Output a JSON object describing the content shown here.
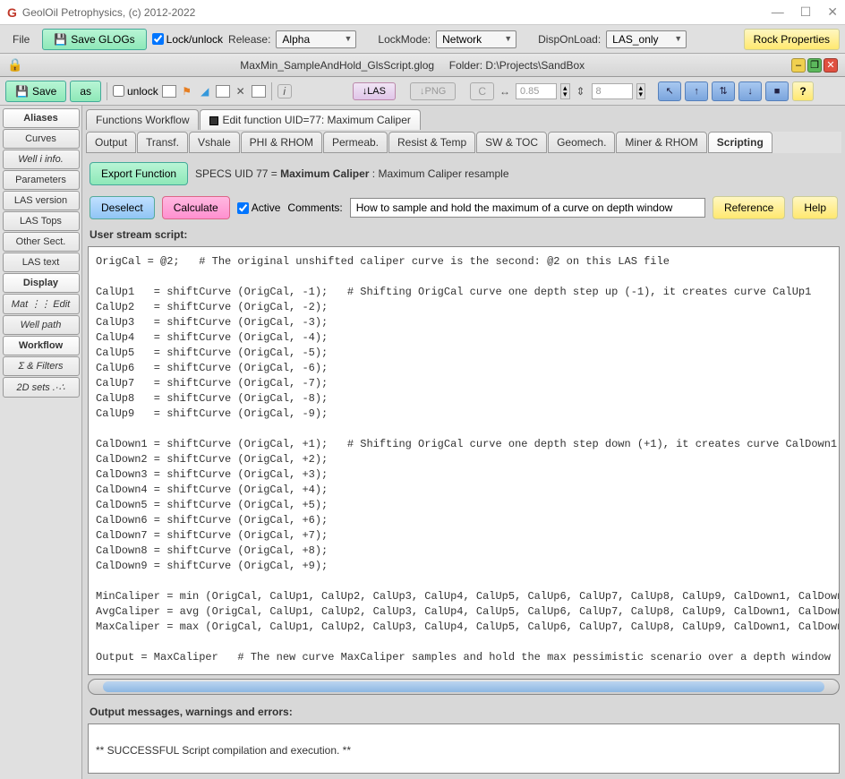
{
  "title": "GeolOil Petrophysics, (c) 2012-2022",
  "menubar": {
    "file": "File",
    "save_glogs": "Save GLOGs",
    "lock_unlock": "Lock/unlock",
    "release_lbl": "Release:",
    "release_val": "Alpha",
    "lockmode_lbl": "LockMode:",
    "lockmode_val": "Network",
    "disp_lbl": "DispOnLoad:",
    "disp_val": "LAS_only",
    "rock": "Rock Properties"
  },
  "filebar": {
    "filename": "MaxMin_SampleAndHold_GlsScript.glog",
    "folder": "Folder: D:\\Projects\\SandBox"
  },
  "toolbar": {
    "save": "Save",
    "as": "as",
    "unlock": "unlock",
    "las": "↓LAS",
    "png": "↓PNG",
    "c": "C",
    "zoom": "0.85",
    "val": "8",
    "help": "?"
  },
  "sidebar": [
    {
      "label": "Aliases",
      "bold": true
    },
    {
      "label": "Curves"
    },
    {
      "label": "Well i info.",
      "italic": true
    },
    {
      "label": "Parameters"
    },
    {
      "label": "LAS version"
    },
    {
      "label": "LAS Tops"
    },
    {
      "label": "Other Sect."
    },
    {
      "label": "LAS text"
    },
    {
      "label": "Display",
      "bold": true
    },
    {
      "label": "Mat ⋮⋮ Edit",
      "italic": true
    },
    {
      "label": "Well path",
      "italic": true
    },
    {
      "label": "Workflow",
      "bold": true
    },
    {
      "label": "Σ & Filters",
      "italic": true
    },
    {
      "label": "2D sets .·∴",
      "italic": true
    }
  ],
  "tabs": {
    "functions": "Functions Workflow",
    "edit": "Edit function UID=77: Maximum Caliper"
  },
  "subtabs": [
    "Output",
    "Transf.",
    "Vshale",
    "PHI & RHOM",
    "Permeab.",
    "Resist & Temp",
    "SW & TOC",
    "Geomech.",
    "Miner & RHOM",
    "Scripting"
  ],
  "actions": {
    "export": "Export Function",
    "specs_prefix": "SPECS UID 77 = ",
    "specs_name": "Maximum Caliper",
    "specs_desc": " : Maximum Caliper resample",
    "deselect": "Deselect",
    "calculate": "Calculate",
    "active": "Active",
    "comments_lbl": "Comments:",
    "comments_val": "How to sample and hold the maximum of a curve on depth window",
    "reference": "Reference",
    "help": "Help"
  },
  "labels": {
    "user_stream": "User stream script:",
    "output_msgs": "Output messages, warnings and errors:"
  },
  "script": "OrigCal = @2;   # The original unshifted caliper curve is the second: @2 on this LAS file\n\nCalUp1   = shiftCurve (OrigCal, -1);   # Shifting OrigCal curve one depth step up (-1), it creates curve CalUp1\nCalUp2   = shiftCurve (OrigCal, -2);\nCalUp3   = shiftCurve (OrigCal, -3);\nCalUp4   = shiftCurve (OrigCal, -4);\nCalUp5   = shiftCurve (OrigCal, -5);\nCalUp6   = shiftCurve (OrigCal, -6);\nCalUp7   = shiftCurve (OrigCal, -7);\nCalUp8   = shiftCurve (OrigCal, -8);\nCalUp9   = shiftCurve (OrigCal, -9);\n\nCalDown1 = shiftCurve (OrigCal, +1);   # Shifting OrigCal curve one depth step down (+1), it creates curve CalDown1\nCalDown2 = shiftCurve (OrigCal, +2);\nCalDown3 = shiftCurve (OrigCal, +3);\nCalDown4 = shiftCurve (OrigCal, +4);\nCalDown5 = shiftCurve (OrigCal, +5);\nCalDown6 = shiftCurve (OrigCal, +6);\nCalDown7 = shiftCurve (OrigCal, +7);\nCalDown8 = shiftCurve (OrigCal, +8);\nCalDown9 = shiftCurve (OrigCal, +9);\n\nMinCaliper = min (OrigCal, CalUp1, CalUp2, CalUp3, CalUp4, CalUp5, CalUp6, CalUp7, CalUp8, CalUp9, CalDown1, CalDown\nAvgCaliper = avg (OrigCal, CalUp1, CalUp2, CalUp3, CalUp4, CalUp5, CalUp6, CalUp7, CalUp8, CalUp9, CalDown1, CalDown\nMaxCaliper = max (OrigCal, CalUp1, CalUp2, CalUp3, CalUp4, CalUp5, CalUp6, CalUp7, CalUp8, CalUp9, CalDown1, CalDown\n\nOutput = MaxCaliper   # The new curve MaxCaliper samples and hold the max pessimistic scenario over a depth window",
  "output_text": "** SUCCESSFUL Script compilation and execution. **"
}
